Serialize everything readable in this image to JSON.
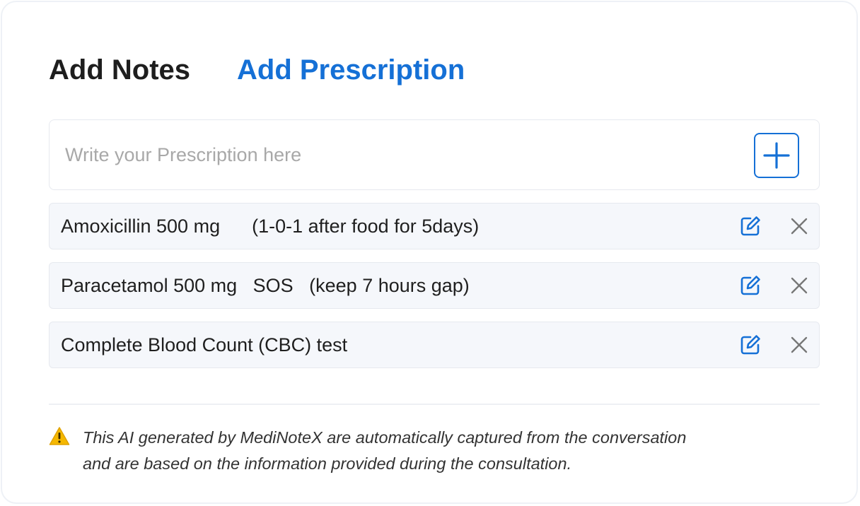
{
  "tabs": {
    "notes_label": "Add Notes",
    "prescription_label": "Add Prescription"
  },
  "prescription_input": {
    "placeholder": "Write your Prescription here",
    "value": ""
  },
  "add_button": {
    "icon": "plus-icon"
  },
  "prescriptions": [
    {
      "text": "Amoxicillin 500 mg      (1-0-1 after food for 5days)"
    },
    {
      "text": "Paracetamol 500 mg   SOS   (keep 7 hours gap)"
    },
    {
      "text": "Complete Blood Count (CBC) test"
    }
  ],
  "row_icons": {
    "edit": "edit-icon",
    "delete": "close-icon"
  },
  "disclaimer": {
    "icon": "warning-icon",
    "line1": "This AI generated by MediNoteX are automatically captured from the conversation",
    "line2": "and are based on the information provided during the consultation."
  },
  "colors": {
    "accent": "#1570d6",
    "row_background": "#f5f7fb",
    "warning": "#f5b800"
  }
}
